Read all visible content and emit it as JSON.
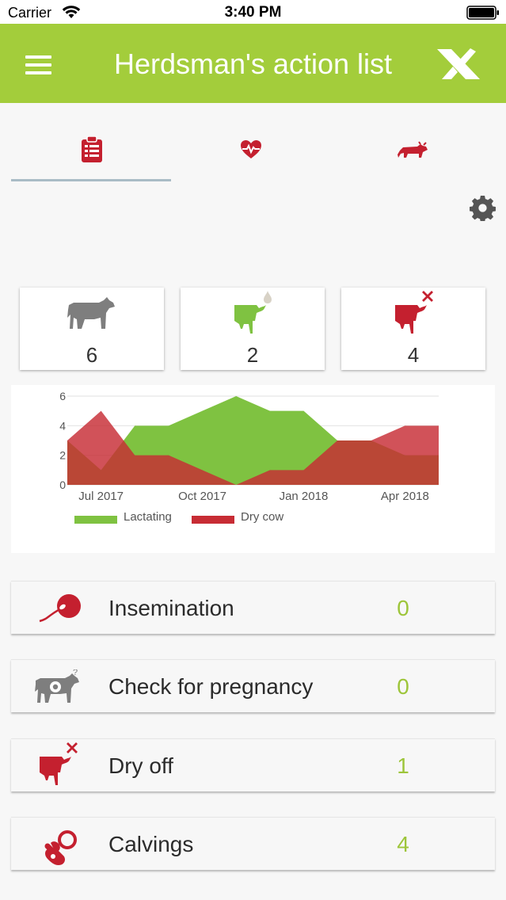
{
  "status_bar": {
    "carrier": "Carrier",
    "time": "3:40 PM"
  },
  "header": {
    "title": "Herdsman's action list",
    "logo_icon": "x-logo-icon",
    "menu_icon": "hamburger-menu-icon"
  },
  "tabs": [
    {
      "icon": "clipboard-list-icon",
      "selected": true
    },
    {
      "icon": "heart-pulse-icon",
      "selected": false
    },
    {
      "icon": "bull-icon",
      "selected": false
    }
  ],
  "settings_icon": "gear-icon",
  "summary_cards": [
    {
      "icon": "cow-icon",
      "value": "6"
    },
    {
      "icon": "lactating-udder-icon",
      "value": "2"
    },
    {
      "icon": "dry-cow-udder-icon",
      "value": "4"
    }
  ],
  "chart_data": {
    "type": "area",
    "x": [
      "2017-06",
      "2017-07",
      "2017-08",
      "2017-09",
      "2017-10",
      "2017-11",
      "2017-12",
      "2018-01",
      "2018-02",
      "2018-03",
      "2018-04",
      "2018-05"
    ],
    "series": [
      {
        "name": "Lactating",
        "values": [
          3,
          1,
          4,
          4,
          5,
          6,
          5,
          5,
          3,
          3,
          2,
          2
        ],
        "color": "#7fc241"
      },
      {
        "name": "Dry cow",
        "values": [
          3,
          5,
          2,
          2,
          1,
          0,
          1,
          1,
          3,
          3,
          4,
          4
        ],
        "color": "#c72c34"
      }
    ],
    "x_tick_labels": [
      "Jul 2017",
      "Oct 2017",
      "Jan 2018",
      "Apr 2018"
    ],
    "y_ticks": [
      "0",
      "2",
      "4",
      "6"
    ],
    "ylim": [
      0,
      6
    ],
    "grid": true,
    "legend_position": "bottom-left"
  },
  "actions": [
    {
      "label": "Insemination",
      "count": "0",
      "icon": "sperm-egg-icon"
    },
    {
      "label": "Check for pregnancy",
      "count": "0",
      "icon": "pregnancy-check-cow-icon"
    },
    {
      "label": "Dry off",
      "count": "1",
      "icon": "dry-off-udder-icon"
    },
    {
      "label": "Calvings",
      "count": "4",
      "icon": "pacifier-icon"
    }
  ]
}
